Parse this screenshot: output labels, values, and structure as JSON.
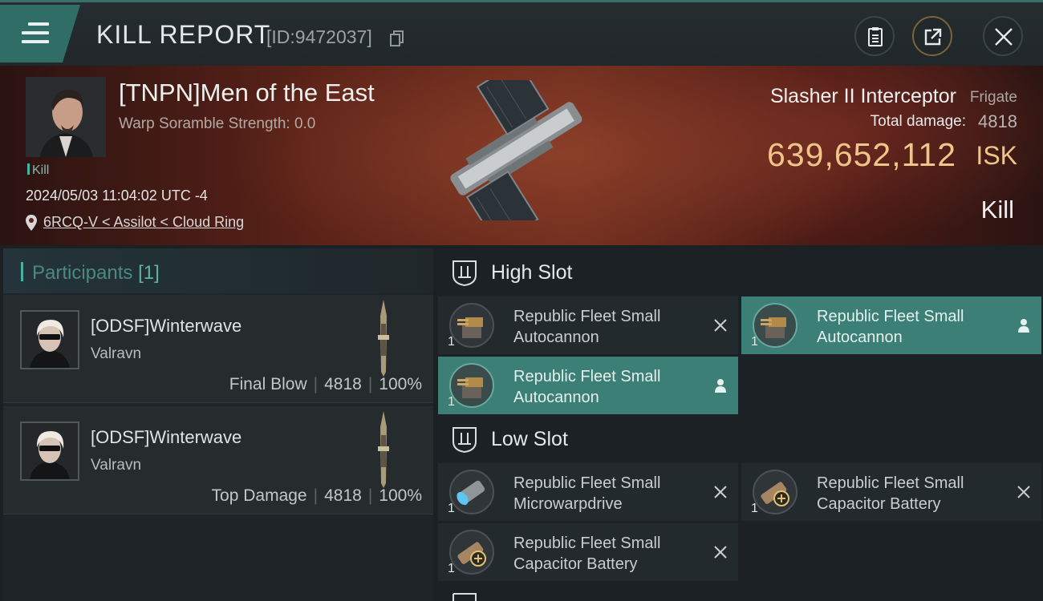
{
  "header": {
    "title": "KILL REPORT",
    "kill_id": "[ID:9472037]",
    "icons": [
      "menu-icon",
      "copy-icon",
      "clipboard-icon",
      "share-icon",
      "close-icon"
    ]
  },
  "victim": {
    "name": "[TNPN]Men of the East",
    "warp_scramble": "Warp Soramble Strength: 0.0",
    "tag": "Kill",
    "datetime": "2024/05/03 11:04:02 UTC -4",
    "location": "6RCQ-V < Assilot < Cloud Ring",
    "ship_name": "Slasher II Interceptor",
    "ship_class": "Frigate",
    "total_damage_label": "Total damage:",
    "total_damage": "4818",
    "isk_value": "639,652,112",
    "isk_unit": "ISK",
    "result": "Kill"
  },
  "participants": {
    "label": "Participants",
    "count": "[1]",
    "rows": [
      {
        "name": "[ODSF]Winterwave",
        "corp": "Valravn",
        "role": "Final Blow",
        "damage": "4818",
        "percent": "100%"
      },
      {
        "name": "[ODSF]Winterwave",
        "corp": "Valravn",
        "role": "Top Damage",
        "damage": "4818",
        "percent": "100%"
      }
    ]
  },
  "slots": {
    "high": {
      "label": "High Slot",
      "modules": [
        {
          "name_line1": "Republic Fleet Small",
          "name_line2": "Autocannon",
          "qty": "1",
          "status": "destroyed",
          "icon": "autocannon-icon"
        },
        {
          "name_line1": "Republic Fleet Small",
          "name_line2": "Autocannon",
          "qty": "1",
          "status": "dropped",
          "icon": "autocannon-icon"
        },
        {
          "name_line1": "Republic Fleet Small",
          "name_line2": "Autocannon",
          "qty": "1",
          "status": "dropped",
          "icon": "autocannon-icon"
        }
      ]
    },
    "low": {
      "label": "Low Slot",
      "modules": [
        {
          "name_line1": "Republic Fleet Small",
          "name_line2": "Microwarpdrive",
          "qty": "1",
          "status": "destroyed",
          "icon": "microwarpdrive-icon"
        },
        {
          "name_line1": "Republic Fleet Small",
          "name_line2": "Capacitor Battery",
          "qty": "1",
          "status": "destroyed",
          "icon": "capacitor-battery-icon"
        },
        {
          "name_line1": "Republic Fleet Small",
          "name_line2": "Capacitor Battery",
          "qty": "1",
          "status": "destroyed",
          "icon": "capacitor-battery-icon"
        }
      ]
    }
  },
  "colors": {
    "accent_teal": "#3c7f76",
    "isk_gold": "#f0c58a",
    "banner_red": "#6b2a1c"
  }
}
